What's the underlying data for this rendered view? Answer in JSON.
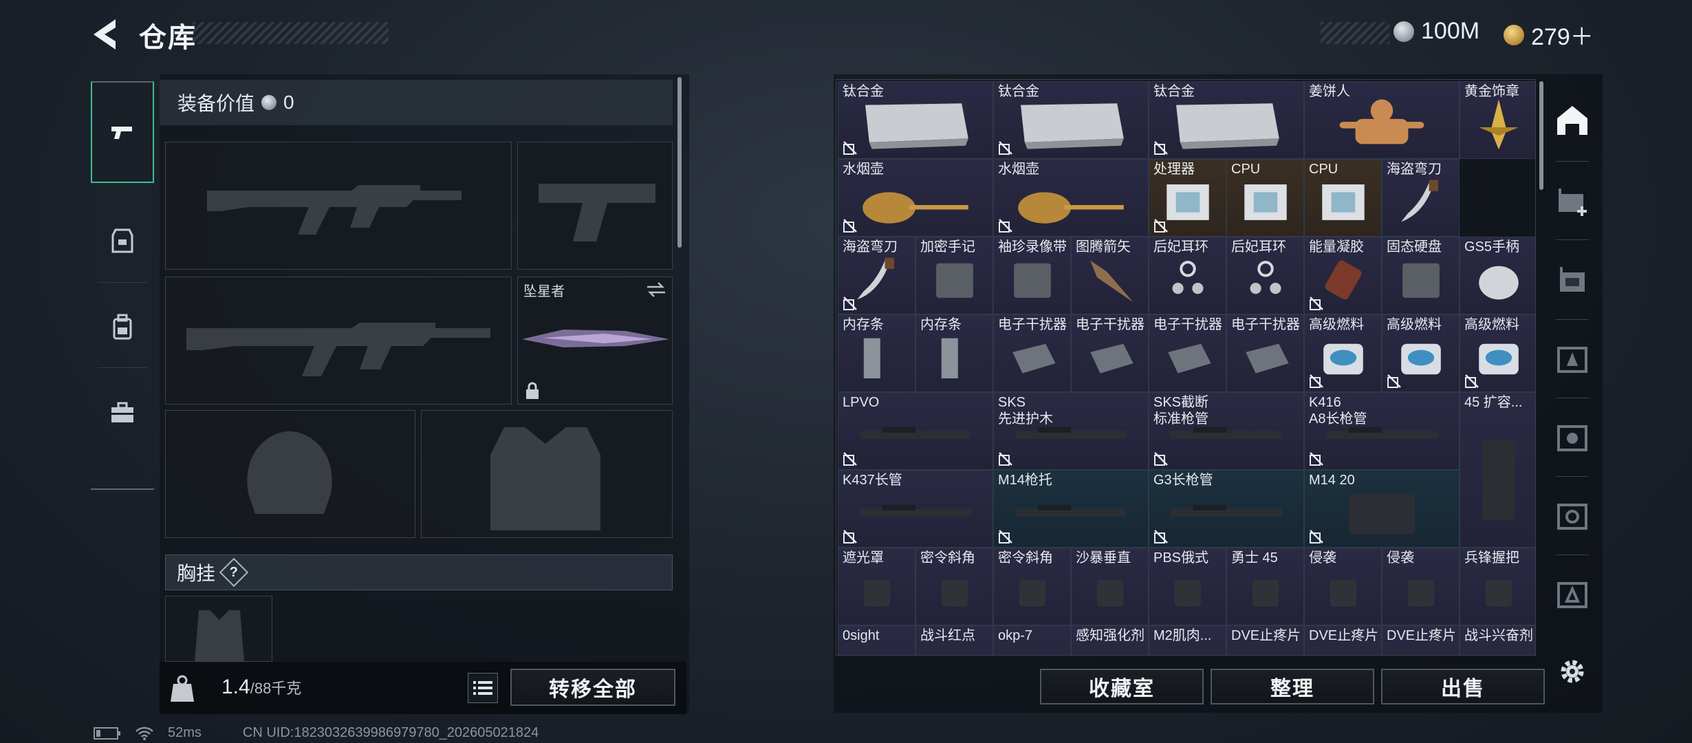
{
  "header": {
    "title": "仓库",
    "currency": [
      {
        "icon": "silver-coin-icon",
        "value": "100M"
      },
      {
        "icon": "gold-coin-icon",
        "value": "279＋"
      }
    ]
  },
  "equip": {
    "value_label": "装备价值",
    "value": "0",
    "melee_name": "坠星者",
    "chest_label": "胸挂",
    "chest_help": "?",
    "weight": "1.4",
    "weight_max": "/88千克",
    "transfer_all": "转移全部"
  },
  "items": [
    {
      "name": "钛合金",
      "c": "purple"
    },
    {
      "name": "钛合金",
      "c": "purple"
    },
    {
      "name": "钛合金",
      "c": "purple"
    },
    {
      "name": "姜饼人",
      "c": "purple"
    },
    {
      "name": "黄金饰章",
      "c": "purple"
    },
    {
      "name": "水烟壶",
      "c": "purple"
    },
    {
      "name": "水烟壶",
      "c": "purple"
    },
    {
      "name": "处理器",
      "c": "gold"
    },
    {
      "name": "CPU",
      "c": "gold"
    },
    {
      "name": "CPU",
      "c": "gold"
    },
    {
      "name": "海盗弯刀",
      "c": "purple"
    },
    {
      "name": "海盗弯刀",
      "c": "purple"
    },
    {
      "name": "加密手记",
      "c": "purple"
    },
    {
      "name": "袖珍录像带",
      "c": "purple"
    },
    {
      "name": "图腾箭矢",
      "c": "purple"
    },
    {
      "name": "后妃耳环",
      "c": "purple"
    },
    {
      "name": "后妃耳环",
      "c": "purple"
    },
    {
      "name": "能量凝胶",
      "c": "purple"
    },
    {
      "name": "固态硬盘",
      "c": "purple"
    },
    {
      "name": "GS5手柄",
      "c": "purple"
    },
    {
      "name": "内存条",
      "c": "purple"
    },
    {
      "name": "内存条",
      "c": "purple"
    },
    {
      "name": "电子干扰器",
      "c": "purple"
    },
    {
      "name": "电子干扰器",
      "c": "purple"
    },
    {
      "name": "电子干扰器",
      "c": "purple"
    },
    {
      "name": "电子干扰器",
      "c": "purple"
    },
    {
      "name": "高级燃料",
      "c": "purple"
    },
    {
      "name": "高级燃料",
      "c": "purple"
    },
    {
      "name": "高级燃料",
      "c": "purple"
    },
    {
      "name": "LPVO",
      "c": "purple"
    },
    {
      "name": "SKS\n先进护木",
      "c": "purple"
    },
    {
      "name": "SKS截断\n标准枪管",
      "c": "purple"
    },
    {
      "name": "K416\nA8长枪管",
      "c": "purple"
    },
    {
      "name": "45 扩容...",
      "c": "purple"
    },
    {
      "name": "K437长管",
      "c": "purple"
    },
    {
      "name": "M14枪托",
      "c": "blue"
    },
    {
      "name": "G3长枪管",
      "c": "blue"
    },
    {
      "name": "M14 20",
      "c": "blue"
    },
    {
      "name": "遮光罩",
      "c": "purple"
    },
    {
      "name": "密令斜角",
      "c": "purple"
    },
    {
      "name": "密令斜角",
      "c": "purple"
    },
    {
      "name": "沙暴垂直",
      "c": "purple"
    },
    {
      "name": "PBS俄式",
      "c": "purple"
    },
    {
      "name": "勇士 45",
      "c": "purple"
    },
    {
      "name": "侵袭",
      "c": "purple"
    },
    {
      "name": "侵袭",
      "c": "purple"
    },
    {
      "name": "兵锋握把",
      "c": "purple"
    },
    {
      "name": "0sight",
      "c": "purple"
    },
    {
      "name": "战斗红点",
      "c": "purple"
    },
    {
      "name": "okp-7",
      "c": "purple"
    },
    {
      "name": "感知强化剂",
      "c": "purple"
    },
    {
      "name": "M2肌肉...",
      "c": "purple"
    },
    {
      "name": "DVE止疼片",
      "c": "purple"
    },
    {
      "name": "DVE止疼片",
      "c": "purple"
    },
    {
      "name": "DVE止疼片",
      "c": "purple"
    },
    {
      "name": "战斗兴奋剂",
      "c": "purple"
    }
  ],
  "actions": {
    "collection": "收藏室",
    "organize": "整理",
    "sell": "出售"
  },
  "status": {
    "ping": "52ms",
    "uid": "CN UID:1823032639986979780_202605021824"
  }
}
